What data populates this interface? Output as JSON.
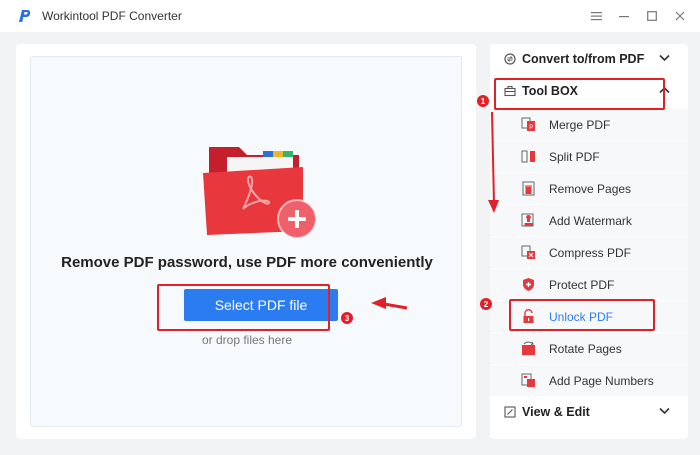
{
  "window": {
    "title": "Workintool PDF Converter"
  },
  "main": {
    "headline": "Remove PDF password, use PDF more conveniently",
    "select_button": "Select PDF file",
    "drop_hint": "or drop files here"
  },
  "sidebar": {
    "convert_section": "Convert to/from PDF",
    "toolbox_section": "Tool BOX",
    "view_section": "View & Edit",
    "tools": [
      {
        "label": "Merge PDF",
        "icon": "merge-icon"
      },
      {
        "label": "Split PDF",
        "icon": "split-icon"
      },
      {
        "label": "Remove Pages",
        "icon": "trash-icon"
      },
      {
        "label": "Add Watermark",
        "icon": "stamp-icon"
      },
      {
        "label": "Compress PDF",
        "icon": "compress-icon"
      },
      {
        "label": "Protect PDF",
        "icon": "shield-icon"
      },
      {
        "label": "Unlock PDF",
        "icon": "unlock-icon"
      },
      {
        "label": "Rotate Pages",
        "icon": "rotate-icon"
      },
      {
        "label": "Add Page Numbers",
        "icon": "page-numbers-icon"
      }
    ],
    "active_tool": "Unlock PDF"
  },
  "annotations": {
    "step1": "1",
    "step2": "2",
    "step3": "3"
  },
  "colors": {
    "accent": "#2b7cf0",
    "annotation": "#e0212a",
    "brand": "#e8383d"
  }
}
